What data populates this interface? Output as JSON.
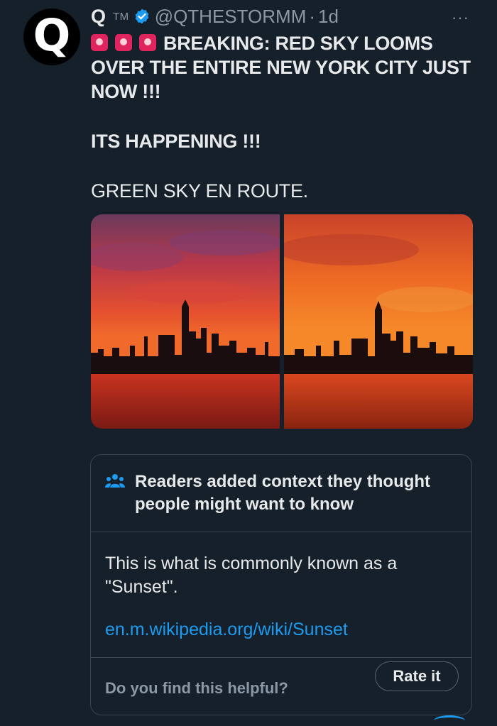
{
  "author": {
    "avatar_letter": "Q",
    "name": "Q",
    "tm": "TM",
    "handle": "@QTHESTORMM",
    "separator": "·",
    "time": "1d"
  },
  "more_label": "···",
  "tweet": {
    "line1": "BREAKING: RED SKY LOOMS OVER THE ENTIRE NEW YORK CITY JUST NOW !!!",
    "line2": "ITS HAPPENING !!!",
    "line3": "GREEN SKY EN ROUTE."
  },
  "community_note": {
    "title": "Readers added context they thought people might want to know",
    "body": "This is what is commonly known as a \"Sunset\".",
    "link": "en.m.wikipedia.org/wiki/Sunset",
    "helpful_prompt": "Do you find this helpful?",
    "rate_label": "Rate it"
  },
  "colors": {
    "background": "#15202b",
    "accent": "#1d9bf0",
    "muted": "#8b98a5",
    "border": "#38444d"
  },
  "icons": [
    "verified-icon",
    "siren-emoji",
    "people-icon",
    "more-icon"
  ]
}
